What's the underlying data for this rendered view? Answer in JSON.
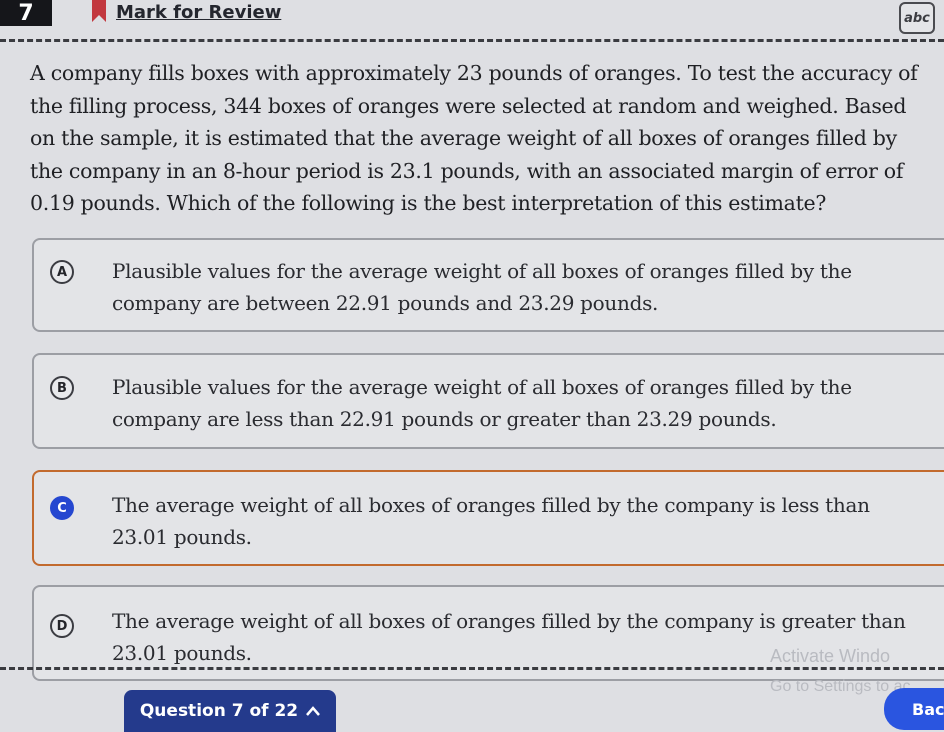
{
  "header": {
    "question_number": "7",
    "mark_label": "Mark for Review",
    "annotate_label": "abc"
  },
  "question": {
    "text": "A company fills boxes with approximately 23 pounds of oranges. To test the accuracy of the filling process, 344 boxes of oranges were selected at random and weighed. Based on the sample, it is estimated that the average weight of all boxes of oranges filled by the company in an 8-hour period is 23.1 pounds, with an associated margin of error of 0.19 pounds. Which of the following is the best interpretation of this estimate?"
  },
  "choices": [
    {
      "letter": "A",
      "text": "Plausible values for the average weight of all boxes of oranges filled by the company are between 22.91 pounds and 23.29 pounds."
    },
    {
      "letter": "B",
      "text": "Plausible values for the average weight of all boxes of oranges filled by the company are less than 22.91 pounds or greater than 23.29 pounds."
    },
    {
      "letter": "C",
      "text": "The average weight of all boxes of oranges filled by the company is less than 23.01 pounds.",
      "selected": true
    },
    {
      "letter": "D",
      "text": "The average weight of all boxes of oranges filled by the company is greater than 23.01 pounds."
    }
  ],
  "footer": {
    "progress_label": "Question 7 of 22",
    "back_label": "Bac"
  },
  "watermark": {
    "line1": "Activate Windo",
    "line2": "Go to Settings to ac"
  },
  "colors": {
    "selected_border": "#c26a2e",
    "selected_badge": "#2547d0",
    "nav_pill": "#243a8c",
    "back_button": "#2a55e0"
  }
}
